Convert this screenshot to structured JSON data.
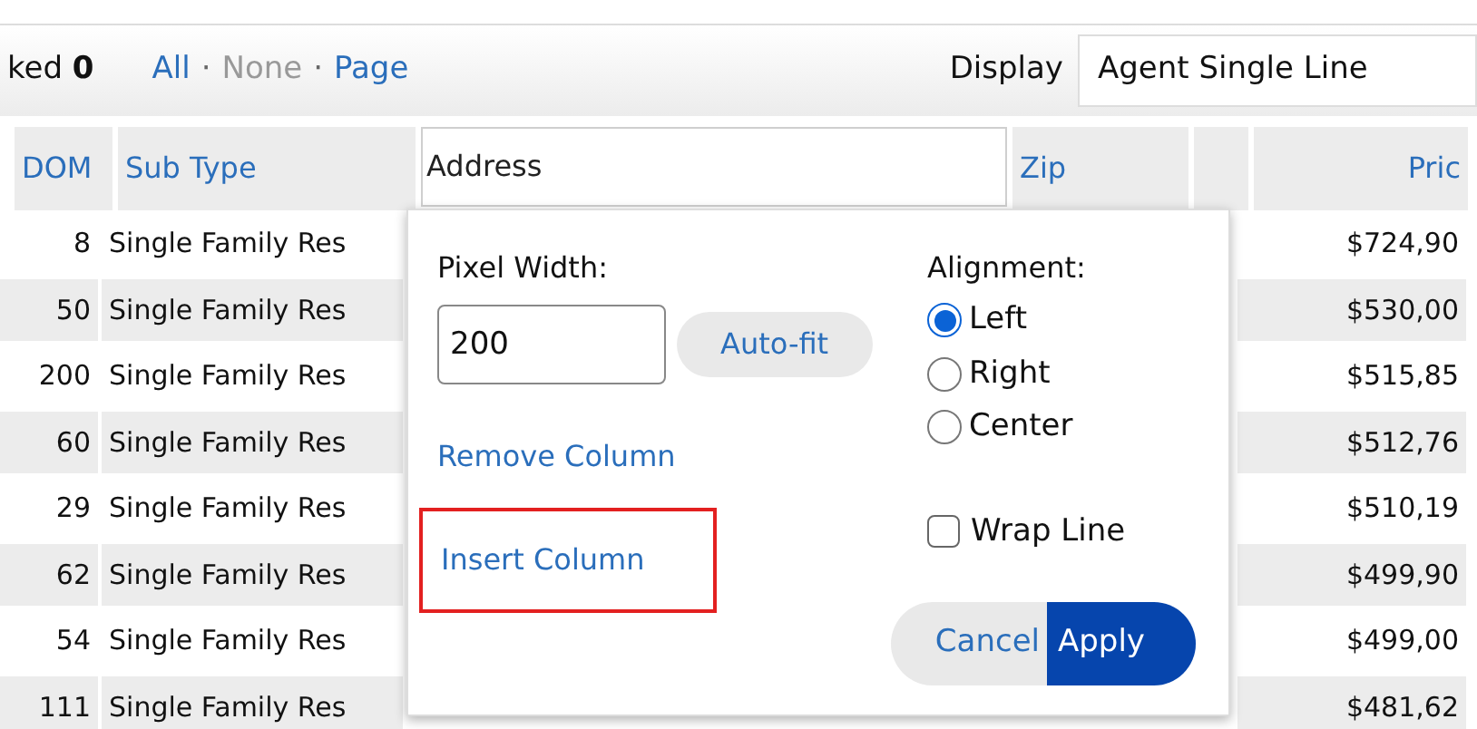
{
  "toolbar": {
    "checked_text": "ked **0**",
    "links": [
      {
        "label": "All",
        "disabled": false
      },
      {
        "label": "None",
        "disabled": true
      },
      {
        "label": "Page",
        "disabled": false
      }
    ],
    "separator": "·",
    "display_label": "Display",
    "display_value": "Agent Single Line"
  },
  "table": {
    "columns": [
      {
        "kind": "link",
        "label": "DOM"
      },
      {
        "kind": "link",
        "label": "Sub Type"
      },
      {
        "kind": "field",
        "label": "Address"
      },
      {
        "kind": "link",
        "label": "Zip"
      },
      {
        "kind": "blank"
      },
      {
        "kind": "link",
        "label": "Pric"
      }
    ],
    "rows": [
      {
        "dom": "8",
        "sub_type": "Single Family Res",
        "price": "$724,90"
      },
      {
        "dom": "50",
        "sub_type": "Single Family Res",
        "price": "$530,00"
      },
      {
        "dom": "200",
        "sub_type": "Single Family Res",
        "price": "$515,85"
      },
      {
        "dom": "60",
        "sub_type": "Single Family Res",
        "price": "$512,76"
      },
      {
        "dom": "29",
        "sub_type": "Single Family Res",
        "price": "$510,19"
      },
      {
        "dom": "62",
        "sub_type": "Single Family Res",
        "price": "$499,90"
      },
      {
        "dom": "54",
        "sub_type": "Single Family Res",
        "price": "$499,00"
      },
      {
        "dom": "111",
        "sub_type": "Single Family Res",
        "price": "$481,62"
      }
    ]
  },
  "popup": {
    "width_label": "Pixel Width:",
    "width_value": "200",
    "autofit": "Auto-fit",
    "remove": "Remove Column",
    "insert": {
      "label": "Insert Column",
      "highlighted": true
    },
    "alignment_label": "Alignment:",
    "alignments": [
      {
        "label": "Left",
        "selected": true
      },
      {
        "label": "Right",
        "selected": false
      },
      {
        "label": "Center",
        "selected": false
      }
    ],
    "wrap": {
      "label": "Wrap Line",
      "checked": false
    },
    "cancel": "Cancel",
    "apply": "Apply"
  }
}
